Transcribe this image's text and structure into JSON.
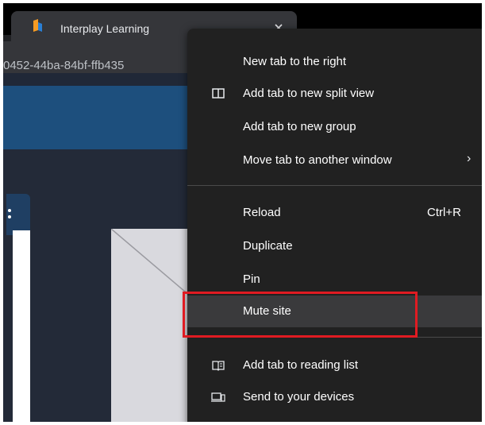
{
  "tab": {
    "title": "Interplay Learning",
    "close_glyph": "×",
    "favicon": "interplay-learning-logo",
    "favicon_colors": [
      "#f59b23",
      "#2a7fd4"
    ]
  },
  "address_bar": {
    "url_fragment": "0452-44ba-84bf-ffb435"
  },
  "context_menu": {
    "items": [
      {
        "label": "New tab to the right",
        "icon": ""
      },
      {
        "label": "Add tab to new split view",
        "icon": "split-view-icon"
      },
      {
        "label": "Add tab to new group",
        "icon": ""
      },
      {
        "label": "Move tab to another window",
        "icon": "",
        "submenu": "›"
      },
      {
        "label": "Reload",
        "icon": "",
        "shortcut": "Ctrl+R"
      },
      {
        "label": "Duplicate",
        "icon": ""
      },
      {
        "label": "Pin",
        "icon": ""
      },
      {
        "label": "Mute site",
        "icon": "",
        "highlighted": true
      },
      {
        "label": "Add tab to reading list",
        "icon": "reading-list-icon"
      },
      {
        "label": "Send to your devices",
        "icon": "devices-icon"
      }
    ]
  },
  "colors": {
    "menu_bg": "#212121",
    "hover_bg": "#3a3a3c",
    "highlight_border": "#e01b22",
    "banner": "#1d4f7d"
  }
}
